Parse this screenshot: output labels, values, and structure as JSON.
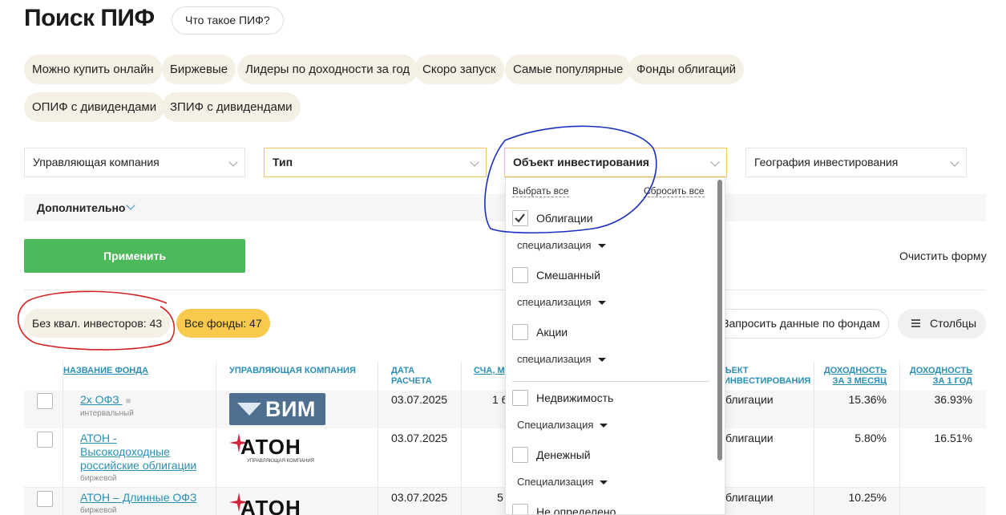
{
  "page": {
    "title": "Поиск ПИФ",
    "info_button": "Что такое ПИФ?"
  },
  "quick_filters": {
    "row1": [
      "Можно купить онлайн",
      "Биржевые",
      "Лидеры по доходности за год",
      "Скоро запуск",
      "Самые популярные",
      "Фонды облигаций"
    ],
    "row2": [
      "ОПИФ с дивидендами",
      "ЗПИФ с дивидендами"
    ]
  },
  "filters": {
    "management_company": "Управляющая компания",
    "type": "Тип",
    "investment_object": "Объект инвестирования",
    "geography": "География инвестирования"
  },
  "advanced": {
    "label": "Дополнительно"
  },
  "actions": {
    "apply": "Применить",
    "clear": "Очистить форму"
  },
  "results": {
    "non_qual": "Без квал. инвесторов: 43",
    "all_funds": "Все фонды: 47",
    "request_data": "Запросить данные по фондам",
    "columns": "Столбцы"
  },
  "table": {
    "headers": {
      "name": "НАЗВАНИЕ ФОНДА",
      "company": "УПРАВЛЯЮЩАЯ КОМПАНИЯ",
      "date": "ДАТА РАСЧЕТА",
      "nav": "СЧА, М",
      "object": "ЪЕКТ ИНВЕСТИРОВАНИЯ",
      "yield3m": "ДОХОДНОСТЬ ЗА 3 МЕСЯЦ",
      "yield1y": "ДОХОДНОСТЬ ЗА 1 ГОД"
    },
    "rows": [
      {
        "name": "2х ОФЗ",
        "sub": "интервальный",
        "company_logo": "ВИМ",
        "date": "03.07.2025",
        "nav": "1 6",
        "object": "блигации",
        "yield3m": "15.36%",
        "yield1y": "36.93%"
      },
      {
        "name_lines": [
          "АТОН -",
          "Высокодоходные",
          "российские облигации"
        ],
        "sub": "биржевой",
        "company_logo": "АТОН",
        "company_sub": "УПРАВЛЯЮЩАЯ КОМПАНИЯ",
        "date": "03.07.2025",
        "object": "блигации",
        "yield3m": "5.80%",
        "yield1y": "16.51%"
      },
      {
        "name": "АТОН – Длинные ОФЗ",
        "sub": "биржевой",
        "company_logo": "АТОН",
        "date": "03.07.2025",
        "nav": "5",
        "object": "блигации",
        "yield3m": "10.25%",
        "yield1y": ""
      }
    ]
  },
  "dropdown": {
    "select_all": "Выбрать все",
    "reset_all": "Сбросить все",
    "items": [
      {
        "label": "Облигации",
        "checked": true,
        "spec": "специализация"
      },
      {
        "label": "Смешанный",
        "checked": false,
        "spec": "специализация"
      },
      {
        "label": "Акции",
        "checked": false,
        "spec": "специализация"
      },
      {
        "label": "Недвижимость",
        "checked": false,
        "spec": "Специализация"
      },
      {
        "label": "Денежный",
        "checked": false,
        "spec": "Специализация"
      },
      {
        "label": "Не определено",
        "checked": false
      }
    ]
  },
  "colors": {
    "accent": "#2a8fb5",
    "apply": "#4cb95b",
    "chip": "#f4f0e6",
    "yellow": "#f9c94e",
    "annotation_blue": "#1a2fc0",
    "annotation_red": "#d42020"
  }
}
